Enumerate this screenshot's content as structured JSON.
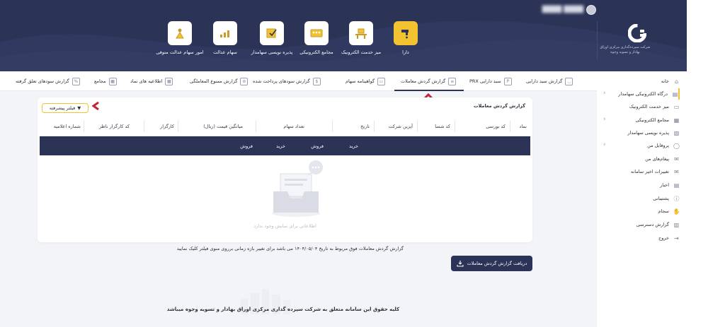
{
  "header": {
    "user_name": "████ ████",
    "logo_text": "شرکت سپرده‌گذاری مرکزی اوراق بهادار و تسویه وجوه",
    "services": [
      {
        "label": "دارا",
        "icon": "tap-icon",
        "active": true
      },
      {
        "label": "میز خدمت الکترونیک",
        "icon": "desk-icon"
      },
      {
        "label": "مجامع الکترونیکی",
        "icon": "assembly-icon"
      },
      {
        "label": "پذیره نویسی سهامدار",
        "icon": "subscription-icon"
      },
      {
        "label": "سهام عدالت",
        "icon": "chart-icon"
      },
      {
        "label": "امور سهام عدالت متوفی",
        "icon": "deceased-icon"
      }
    ]
  },
  "sidebar": {
    "items": [
      {
        "label": "خانه",
        "icon": "home-icon"
      },
      {
        "label": "درگاه الکترونیکی سهامدار",
        "icon": "gateway-icon",
        "has_children": true,
        "active": true
      },
      {
        "label": "میز خدمت الکترونیک",
        "icon": "desk-icon"
      },
      {
        "label": "مجامع الکترونیکی",
        "icon": "assembly-icon",
        "has_children": true
      },
      {
        "label": "پذیره نویسی سهامدار",
        "icon": "subscription-icon"
      },
      {
        "label": "پروفایل من",
        "icon": "user-icon",
        "has_children": true
      },
      {
        "label": "پیغام‌های من",
        "icon": "mail-icon"
      },
      {
        "label": "تغییرات اخیر سامانه",
        "icon": "mail-icon"
      },
      {
        "label": "اخبار",
        "icon": "news-icon"
      },
      {
        "label": "پشتیبانی",
        "icon": "info-icon"
      },
      {
        "label": "سجام",
        "icon": "handshake-icon"
      },
      {
        "label": "گزارش دسترسی",
        "icon": "report-icon"
      },
      {
        "label": "خروج",
        "icon": "logout-icon"
      }
    ]
  },
  "tabs": [
    {
      "label": "گزارش سبد دارایی",
      "icon": "basket-icon"
    },
    {
      "label": "سبد دارایی PRX",
      "icon": "prx-icon"
    },
    {
      "label": "گزارش گردش معاملات",
      "icon": "trades-icon",
      "active": true
    },
    {
      "label": "گواهینامه سهام",
      "icon": "certificate-icon"
    },
    {
      "label": "گزارش سودهای پرداخت شده",
      "icon": "dividend-icon"
    },
    {
      "label": "گزارش ممنوع المعاملگی",
      "icon": "ban-icon"
    },
    {
      "label": "اطلاعیه های نماد",
      "icon": "notice-icon"
    },
    {
      "label": "مجامع",
      "icon": "assembly-icon"
    },
    {
      "label": "گزارش سودهای تعلق گرفته",
      "icon": "accrued-icon"
    }
  ],
  "card": {
    "title": "گزارش گردش معاملات",
    "filter_label": "فیلتر پیشرفته",
    "columns": [
      "نماد",
      "کد بورسی",
      "کد شسا",
      "آیزین شرکت",
      "تاریخ",
      "تعداد سهام",
      "میانگین قیمت (ریال)",
      "کارگزار",
      "کد کارگزار ناظر",
      "شماره اعلامیه"
    ],
    "sub_columns": [
      "خرید",
      "فروش",
      "خرید",
      "فروش"
    ],
    "empty_text": "اطلاعاتی برای نمایش وجود ندارد"
  },
  "note": "گزارش گردش معاملات فوق مربوط به تاریخ ۱۴۰۴/۰۵/۰۴ می باشد برای تغییر بازه زمانی برروی منوی فیلتر کلیک نمایید",
  "download_label": "دریافت گزارش گردش معاملات",
  "footer": "کلیه حقوق این سامانه متعلق به شرکت سپرده گذاری مرکزی اوراق بهادار و تسویه وجوه میباشد",
  "colors": {
    "navy": "#2b3356",
    "accent": "#f2c230",
    "chevron": "#c0263a"
  }
}
